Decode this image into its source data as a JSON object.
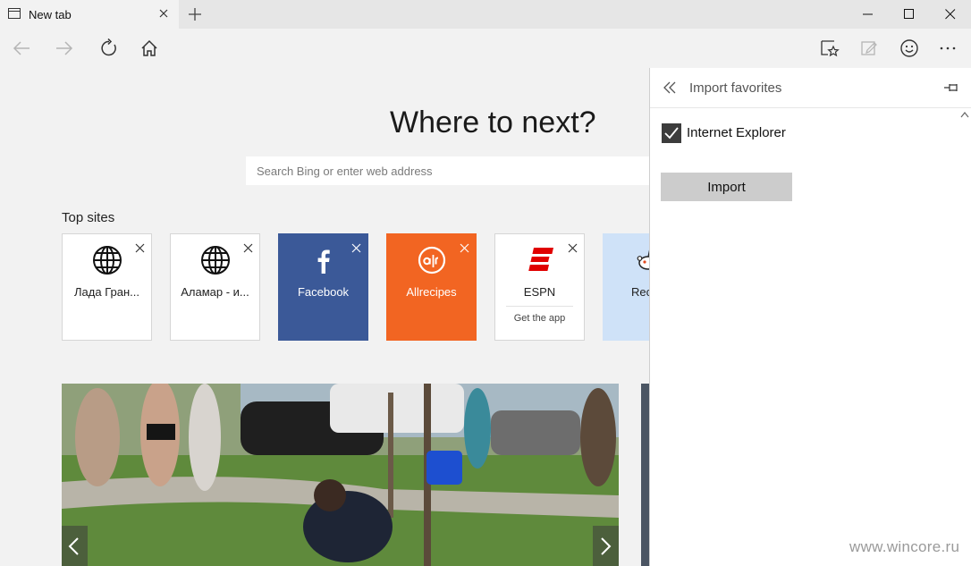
{
  "tab": {
    "title": "New tab",
    "icon": "page-icon",
    "close_icon": "close-icon"
  },
  "titlebar": {
    "new_tab_icon": "plus-icon",
    "minimize_icon": "minimize-icon",
    "maximize_icon": "maximize-icon",
    "close_icon": "close-icon"
  },
  "navbar": {
    "back_icon": "arrow-left-icon",
    "forward_icon": "arrow-right-icon",
    "refresh_icon": "refresh-icon",
    "home_icon": "home-icon",
    "hub_icon": "favorites-star-icon",
    "note_icon": "web-note-icon",
    "feedback_icon": "smiley-icon",
    "more_icon": "ellipsis-icon"
  },
  "main": {
    "headline": "Where to next?",
    "search_placeholder": "Search Bing or enter web address",
    "topsites_label": "Top sites",
    "tiles": [
      {
        "label": "Лада Гран...",
        "icon": "globe-icon",
        "sub": ""
      },
      {
        "label": "Аламар - и...",
        "icon": "globe-icon",
        "sub": ""
      },
      {
        "label": "Facebook",
        "icon": "facebook-icon",
        "sub": ""
      },
      {
        "label": "Allrecipes",
        "icon": "allrecipes-icon",
        "sub": ""
      },
      {
        "label": "ESPN",
        "icon": "espn-icon",
        "sub": "Get the app"
      },
      {
        "label": "Rec",
        "icon": "reddit-icon",
        "sub": ""
      }
    ]
  },
  "panel": {
    "title": "Import favorites",
    "back_icon": "double-chevron-left-icon",
    "pin_icon": "pin-icon",
    "checkbox_label": "Internet Explorer",
    "checkbox_checked": true,
    "import_button": "Import"
  },
  "watermark": "www.wincore.ru",
  "colors": {
    "facebook": "#3b5998",
    "allrecipes": "#f26522",
    "espn": "#e00000",
    "reddit_tile": "#cfe2f8",
    "checkbox": "#3c3c3c"
  }
}
